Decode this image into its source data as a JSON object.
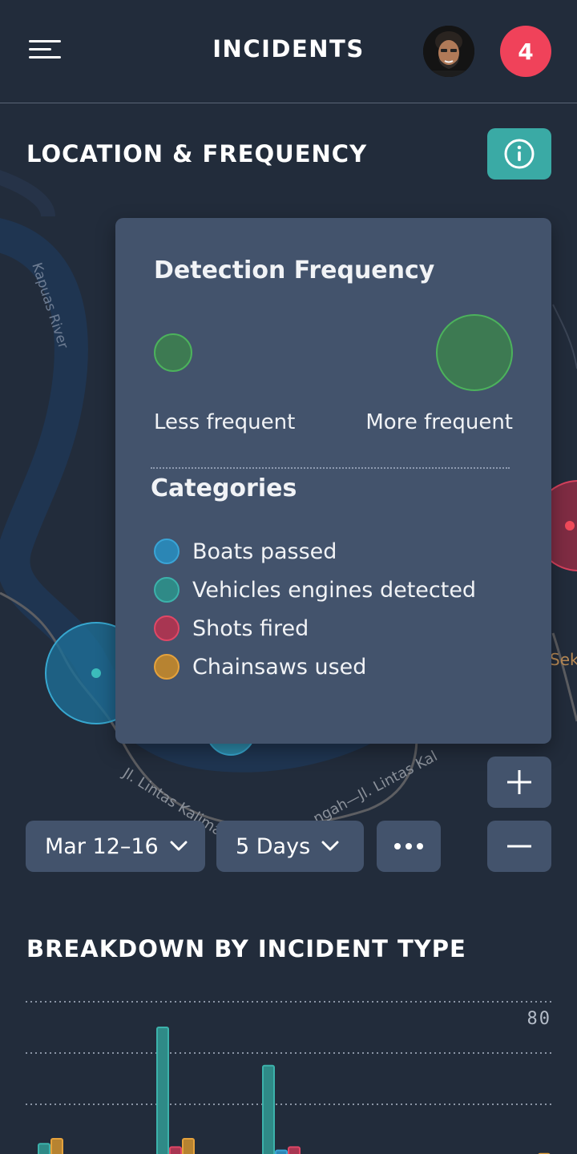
{
  "header": {
    "title": "INCIDENTS",
    "notification_count": "4"
  },
  "location_section": {
    "title": "LOCATION & FREQUENCY"
  },
  "map": {
    "river_label": "Kapuas River",
    "road_label_1": "Jl. Lintas Kalima",
    "road_label_2": "ngah—Jl. Lintas Kal",
    "place_label": "Seka"
  },
  "legend": {
    "title": "Detection Frequency",
    "less_label": "Less frequent",
    "more_label": "More frequent",
    "categories_title": "Categories",
    "categories": [
      {
        "label": "Boats passed",
        "color": "#2b86b5"
      },
      {
        "label": "Vehicles engines detected",
        "color": "#2f8a87"
      },
      {
        "label": "Shots fired",
        "color": "#a83652"
      },
      {
        "label": "Chainsaws used",
        "color": "#b78331"
      }
    ]
  },
  "filters": {
    "date_range": "Mar 12–16",
    "period": "5 Days"
  },
  "breakdown_section": {
    "title": "BREAKDOWN BY INCIDENT TYPE"
  },
  "chart_data": {
    "type": "bar",
    "tick_labels": [
      "80"
    ],
    "series": [
      {
        "color": "#2f8a87",
        "values": [
          10,
          80,
          57,
          0,
          3,
          0
        ]
      },
      {
        "color": "#2b86b5",
        "values": [
          0,
          0,
          6,
          0,
          0,
          0
        ]
      },
      {
        "color": "#a83652",
        "values": [
          0,
          8,
          8,
          0,
          0,
          0
        ]
      },
      {
        "color": "#b78331",
        "values": [
          13,
          13,
          0,
          0,
          0,
          4
        ]
      }
    ]
  },
  "colors": {
    "background": "#222c3b",
    "panel": "#43536c",
    "accent": "#3aaaa5",
    "badge": "#f0425a"
  }
}
